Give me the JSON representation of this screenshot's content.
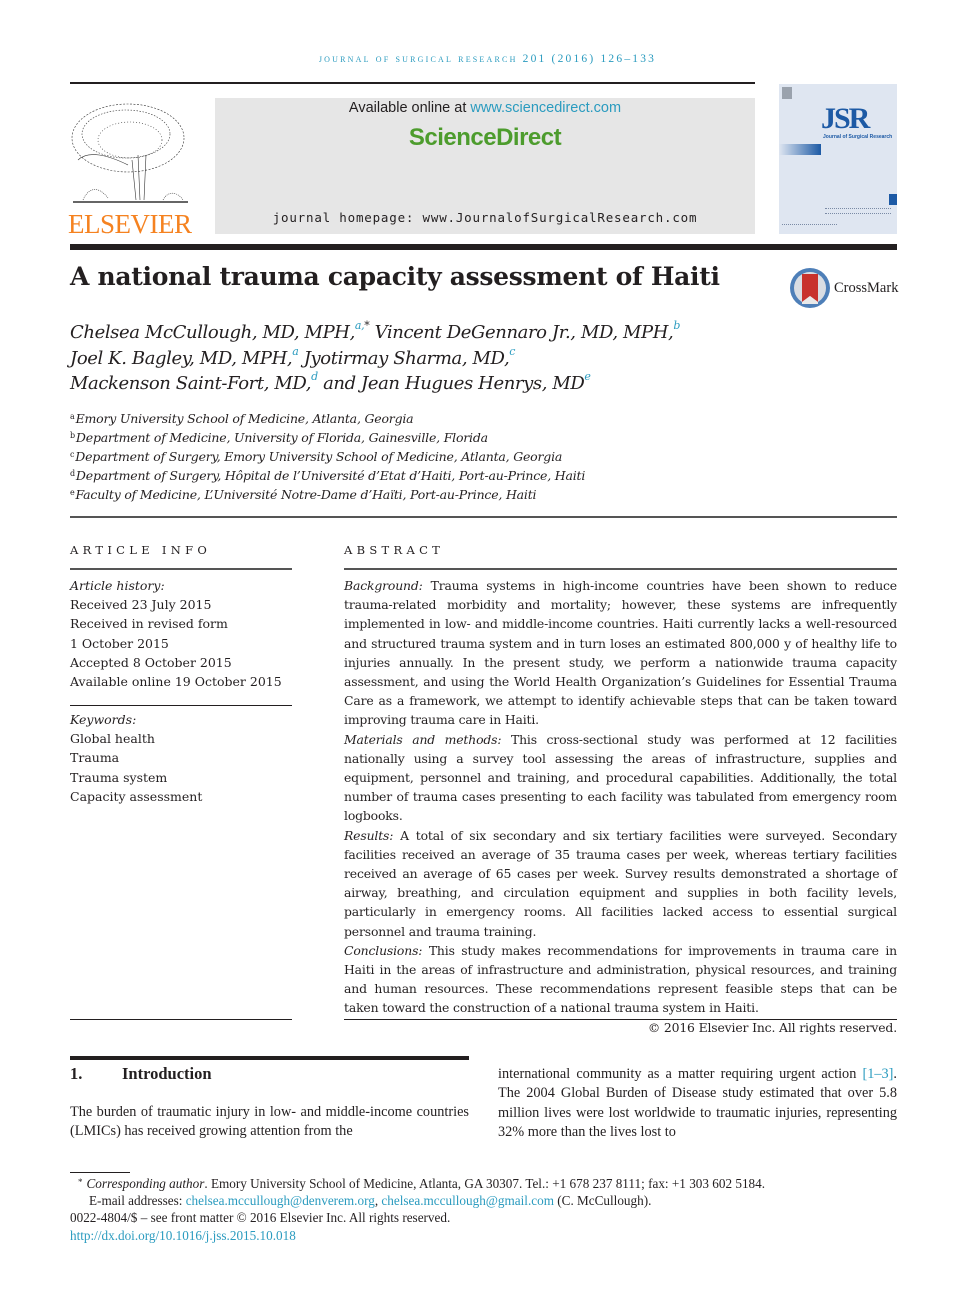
{
  "header": {
    "journal_line": "Journal of Surgical Research 201 (2016) 126–133",
    "publisher_logo": "ELSEVIER",
    "available_prefix": "Available online at ",
    "available_link": "www.sciencedirect.com",
    "sciencedirect": "ScienceDirect",
    "homepage": "journal homepage: www.JournalofSurgicalResearch.com",
    "cover": {
      "abbrev": "JSR",
      "subtitle": "Journal of Surgical Research"
    },
    "brand_colors": {
      "link": "#2a9bbf",
      "elsevier": "#f58220",
      "sciencedirect": "#4d9c2d"
    }
  },
  "article": {
    "title": "A national trauma capacity assessment of Haiti",
    "crossmark": "CrossMark",
    "authors": [
      {
        "name": "Chelsea McCullough, MD, MPH,",
        "sup": "a,",
        "star": "*"
      },
      {
        "name": "Vincent DeGennaro Jr., MD, MPH,",
        "sup": "b"
      },
      {
        "name": "Joel K. Bagley, MD, MPH,",
        "sup": "a"
      },
      {
        "name": "Jyotirmay Sharma, MD,",
        "sup": "c"
      },
      {
        "name": "Mackenson Saint-Fort, MD,",
        "sup": "d"
      },
      {
        "name": "and Jean Hugues Henrys, MD",
        "sup": "e"
      }
    ],
    "affiliations": [
      {
        "key": "a",
        "text": "Emory University School of Medicine, Atlanta, Georgia"
      },
      {
        "key": "b",
        "text": "Department of Medicine, University of Florida, Gainesville, Florida"
      },
      {
        "key": "c",
        "text": "Department of Surgery, Emory University School of Medicine, Atlanta, Georgia"
      },
      {
        "key": "d",
        "text": "Department of Surgery, Hôpital de l’Université d’Etat d’Haiti, Port-au-Prince, Haiti"
      },
      {
        "key": "e",
        "text": "Faculty of Medicine, L’Université Notre-Dame d’Haïti, Port-au-Prince, Haiti"
      }
    ]
  },
  "article_info": {
    "heading": "ARTICLE INFO",
    "history_label": "Article history:",
    "history": [
      "Received 23 July 2015",
      "Received in revised form",
      "1 October 2015",
      "Accepted 8 October 2015",
      "Available online 19 October 2015"
    ],
    "keywords_label": "Keywords:",
    "keywords": [
      "Global health",
      "Trauma",
      "Trauma system",
      "Capacity assessment"
    ]
  },
  "abstract": {
    "heading": "ABSTRACT",
    "sections": [
      {
        "label": "Background:",
        "text": " Trauma systems in high-income countries have been shown to reduce trauma-related morbidity and mortality; however, these systems are infrequently implemented in low- and middle-income countries. Haiti currently lacks a well-resourced and structured trauma system and in turn loses an estimated 800,000 y of healthy life to injuries annually. In the present study, we perform a nationwide trauma capacity assessment, and using the World Health Organization’s Guidelines for Essential Trauma Care as a framework, we attempt to identify achievable steps that can be taken toward improving trauma care in Haiti."
      },
      {
        "label": "Materials and methods:",
        "text": " This cross-sectional study was performed at 12 facilities nationally using a survey tool assessing the areas of infrastructure, supplies and equipment, personnel and training, and procedural capabilities. Additionally, the total number of trauma cases presenting to each facility was tabulated from emergency room logbooks."
      },
      {
        "label": "Results:",
        "text": " A total of six secondary and six tertiary facilities were surveyed. Secondary facilities received an average of 35 trauma cases per week, whereas tertiary facilities received an average of 65 cases per week. Survey results demonstrated a shortage of airway, breathing, and circulation equipment and supplies in both facility levels, particularly in emergency rooms. All facilities lacked access to essential surgical personnel and trauma training."
      },
      {
        "label": "Conclusions:",
        "text": " This study makes recommendations for improvements in trauma care in Haiti in the areas of infrastructure and administration, physical resources, and training and human resources. These recommendations represent feasible steps that can be taken toward the construction of a national trauma system in Haiti."
      }
    ],
    "copyright": "© 2016 Elsevier Inc. All rights reserved."
  },
  "body": {
    "section_number": "1.",
    "section_title": "Introduction",
    "left_text": "The burden of traumatic injury in low- and middle-income countries (LMICs) has received growing attention from the",
    "right_text_1": "international community as a matter requiring urgent action ",
    "right_ref": "[1–3]",
    "right_text_2": ". The 2004 Global Burden of Disease study estimated that over 5.8 million lives were lost worldwide to traumatic injuries, representing 32% more than the lives lost to"
  },
  "footnotes": {
    "star": "*",
    "corr_label": "Corresponding author",
    "corr_text": ". Emory University School of Medicine, Atlanta, GA 30307. Tel.: +1 678 237 8111; fax: +1 303 602 5184.",
    "email_label": "E-mail addresses: ",
    "email1": "chelsea.mccullough@denverem.org",
    "email_sep": ", ",
    "email2": "chelsea.mccullough@gmail.com",
    "email_owner": " (C. McCullough).",
    "front_matter": "0022-4804/$ – see front matter © 2016 Elsevier Inc. All rights reserved.",
    "doi": "http://dx.doi.org/10.1016/j.jss.2015.10.018"
  }
}
